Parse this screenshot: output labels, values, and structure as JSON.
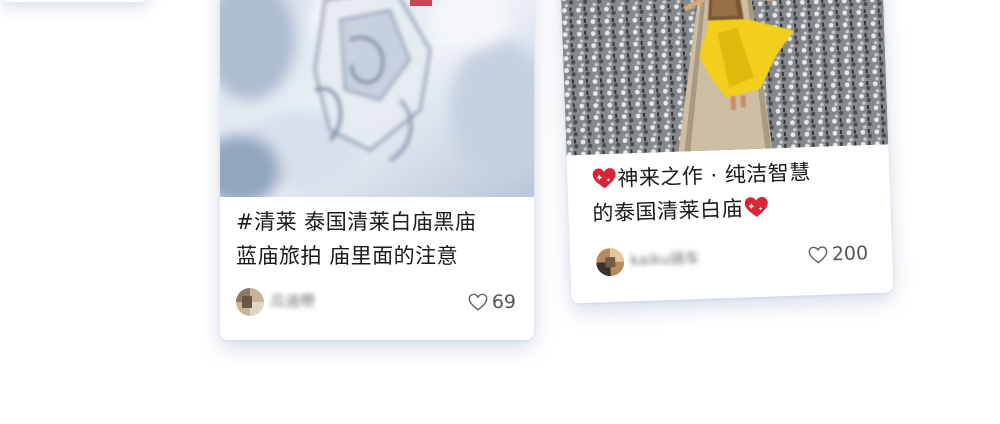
{
  "feed": {
    "cards": [
      {
        "title_line1": "#清莱 泰国清莱白庙黑庙",
        "title_line2": "蓝庙旅拍 庙里面的注意",
        "author": "瓜迪嘢",
        "likes": "69",
        "image": "white-temple-carving"
      },
      {
        "title_line1": "神来之作 · 纯洁智慧",
        "title_line2": "的泰国清莱白庙",
        "author": "kaiku骑车",
        "likes": "200",
        "image": "woman-yellow-dress-white-temple",
        "emoji": "sparkling-heart-icon"
      }
    ]
  },
  "colors": {
    "card_shadow": "#5070a0",
    "dress_yellow": "#f2cf1c",
    "heart_red": "#d8253a"
  }
}
